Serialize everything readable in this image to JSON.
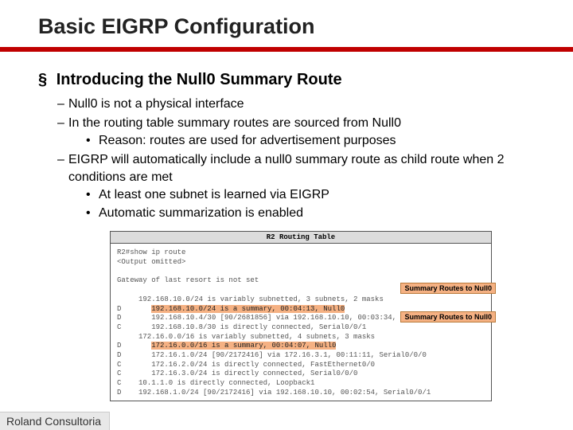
{
  "title": "Basic EIGRP Configuration",
  "section": {
    "heading": "Introducing the Null0 Summary Route",
    "items": [
      {
        "text": "Null0 is not a physical interface"
      },
      {
        "text": "In the routing table summary routes are sourced from Null0",
        "sub": [
          "Reason:  routes are used for advertisement purposes"
        ]
      },
      {
        "text": "EIGRP will automatically include a null0 summary route as child route when 2 conditions are met",
        "sub": [
          "At least one subnet is learned via EIGRP",
          "Automatic summarization is enabled"
        ]
      }
    ]
  },
  "figure": {
    "caption": "R2 Routing Table",
    "cmd1": "R2#show ip route",
    "cmd2": "<Output omitted>",
    "gw": "Gateway of last resort is not set",
    "l1": "     192.168.10.0/24 is variably subnetted, 3 subnets, 2 masks",
    "l2p": "D       ",
    "l2h": "192.168.10.0/24 is a summary, 00:04:13, Null0",
    "l3": "D       192.168.10.4/30 [90/2681856] via 192.168.10.10, 00:03:34, Serial0/0/1",
    "l4": "C       192.168.10.8/30 is directly connected, Serial0/0/1",
    "l5": "     172.16.0.0/16 is variably subnetted, 4 subnets, 3 masks",
    "l6p": "D       ",
    "l6h": "172.16.0.0/16 is a summary, 00:04:07, Null0",
    "l7": "D       172.16.1.0/24 [90/2172416] via 172.16.3.1, 00:11:11, Serial0/0/0",
    "l8": "C       172.16.2.0/24 is directly connected, FastEthernet0/0",
    "l9": "C       172.16.3.0/24 is directly connected, Serial0/0/0",
    "l10": "C    10.1.1.0 is directly connected, Loopback1",
    "l11": "D    192.168.1.0/24 [90/2172416] via 192.168.10.10, 00:02:54, Serial0/0/1",
    "callout": "Summary Routes to Null0"
  },
  "footer": "Roland Consultoria"
}
